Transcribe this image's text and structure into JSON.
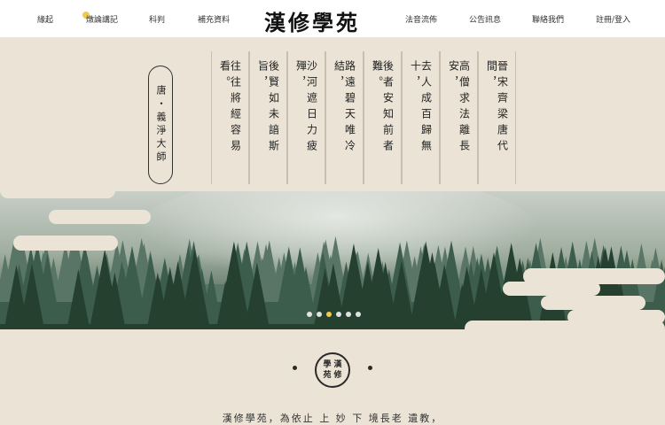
{
  "nav": {
    "left": [
      "緣起",
      "燉論講記",
      "科判",
      "補充資料"
    ],
    "right": [
      "法音流佈",
      "公告訊息",
      "聯絡我們",
      "註冊/登入"
    ]
  },
  "logo": "漢修學苑",
  "poem": {
    "author": "唐・義淨大師",
    "lines": [
      "晉宋齊梁唐代間，",
      "高僧求法離長安，",
      "去人成百歸無十，",
      "後者安知前者難。",
      "路遠碧天唯冷結，",
      "沙河遮日力疲殫，",
      "後賢如未諳斯旨，",
      "往往將經容易看。"
    ]
  },
  "carousel": {
    "count": 6,
    "active_index": 2
  },
  "seal": [
    "學",
    "漢",
    "苑",
    "修"
  ],
  "intro": "漢修學苑，為依止 上 妙 下 境長老 遺教，",
  "colors": {
    "background": "#ebe4d6",
    "accent": "#f2c94c",
    "forest": "#2f4a3b"
  }
}
